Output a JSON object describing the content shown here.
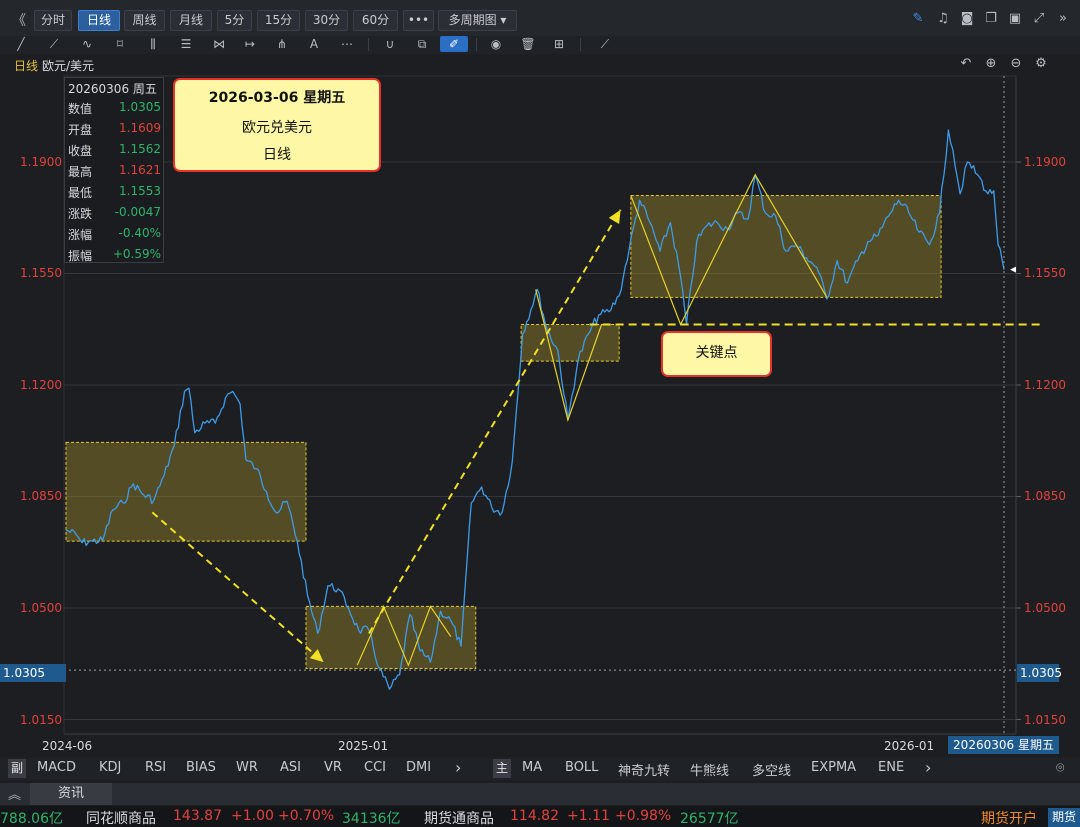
{
  "toolbar": {
    "collapse_glyph": "《",
    "periods": [
      "分时",
      "日线",
      "周线",
      "月线",
      "5分",
      "15分",
      "30分",
      "60分",
      "•••"
    ],
    "active_period": "日线",
    "multi_period": "多周期图 ▾",
    "right_icons": [
      "pencil-icon",
      "bell-icon",
      "camera-icon",
      "copy-icon",
      "monitor-icon",
      "fullscreen-icon",
      "expand-right-icon"
    ]
  },
  "drawing_tools": [
    "line-tool-icon",
    "ray-tool-icon",
    "polyline-tool-icon",
    "rect-tool-icon",
    "fib-tool-icon",
    "channel-tool-icon",
    "gann-tool-icon",
    "measure-tool-icon",
    "pitchfork-tool-icon",
    "text-tool-icon",
    "more-tools-icon",
    "magnet-icon",
    "layer-icon",
    "highlight-pen-icon",
    "eye-icon",
    "trash-icon",
    "grid-icon",
    "ruler-icon"
  ],
  "chart": {
    "period_label": "日线",
    "symbol_label": "欧元/美元",
    "controls": [
      "undo-icon",
      "zoom-in-icon",
      "zoom-out-icon",
      "settings-icon"
    ],
    "info": {
      "header": "20260306  周五",
      "rows": [
        {
          "k": "数值",
          "v": "1.0305",
          "c": "#2fb36a"
        },
        {
          "k": "开盘",
          "v": "1.1609",
          "c": "#e0433b"
        },
        {
          "k": "收盘",
          "v": "1.1562",
          "c": "#2fb36a"
        },
        {
          "k": "最高",
          "v": "1.1621",
          "c": "#e0433b"
        },
        {
          "k": "最低",
          "v": "1.1553",
          "c": "#2fb36a"
        },
        {
          "k": "涨跌",
          "v": "-0.0047",
          "c": "#2fb36a"
        },
        {
          "k": "涨幅",
          "v": "-0.40%",
          "c": "#2fb36a"
        },
        {
          "k": "振幅",
          "v": "+0.59%",
          "c": "#2fb36a"
        }
      ]
    },
    "callout_date": {
      "line1": "2026-03-06 星期五",
      "line2": "欧元兑美元",
      "line3": "日线"
    },
    "callout_key": "关键点",
    "y_ticks": [
      "1.1900",
      "1.1550",
      "1.1200",
      "1.0850",
      "1.0500",
      "1.0150"
    ],
    "x_ticks": [
      "2024-06",
      "2025-01",
      "2026-01"
    ],
    "cursor_value": "1.0305",
    "cursor_date": "20260306 星期五"
  },
  "chart_data": {
    "type": "line",
    "title": "欧元/美元 日线",
    "x_ticks": [
      "2024-06",
      "2025-01",
      "2026-01"
    ],
    "y_ticks": [
      1.19,
      1.155,
      1.12,
      1.085,
      1.05,
      1.015
    ],
    "ylim": [
      1.011,
      1.203
    ],
    "series": [
      {
        "name": "欧元/美元",
        "color": "#3d9be9",
        "points": [
          [
            "2024-06-03",
            1.0745
          ],
          [
            "2024-06-10",
            1.073
          ],
          [
            "2024-06-14",
            1.0705
          ],
          [
            "2024-06-21",
            1.071
          ],
          [
            "2024-06-28",
            1.0712
          ],
          [
            "2024-07-05",
            1.0808
          ],
          [
            "2024-07-12",
            1.083
          ],
          [
            "2024-07-19",
            1.089
          ],
          [
            "2024-07-26",
            1.0855
          ],
          [
            "2024-08-02",
            1.0838
          ],
          [
            "2024-08-09",
            1.0915
          ],
          [
            "2024-08-16",
            1.101
          ],
          [
            "2024-08-23",
            1.118
          ],
          [
            "2024-08-26",
            1.119
          ],
          [
            "2024-08-30",
            1.105
          ],
          [
            "2024-09-06",
            1.108
          ],
          [
            "2024-09-13",
            1.108
          ],
          [
            "2024-09-20",
            1.116
          ],
          [
            "2024-09-25",
            1.118
          ],
          [
            "2024-09-30",
            1.114
          ],
          [
            "2024-10-04",
            1.0965
          ],
          [
            "2024-10-11",
            1.0938
          ],
          [
            "2024-10-18",
            1.0866
          ],
          [
            "2024-10-25",
            1.0798
          ],
          [
            "2024-11-01",
            1.0835
          ],
          [
            "2024-11-08",
            1.071
          ],
          [
            "2024-11-15",
            1.054
          ],
          [
            "2024-11-22",
            1.042
          ],
          [
            "2024-11-29",
            1.057
          ],
          [
            "2024-12-06",
            1.056
          ],
          [
            "2024-12-13",
            1.05
          ],
          [
            "2024-12-20",
            1.043
          ],
          [
            "2024-12-27",
            1.043
          ],
          [
            "2025-01-03",
            1.031
          ],
          [
            "2025-01-10",
            1.0245
          ],
          [
            "2025-01-17",
            1.029
          ],
          [
            "2025-01-24",
            1.048
          ],
          [
            "2025-01-31",
            1.0365
          ],
          [
            "2025-02-07",
            1.033
          ],
          [
            "2025-02-14",
            1.049
          ],
          [
            "2025-02-21",
            1.046
          ],
          [
            "2025-02-28",
            1.038
          ],
          [
            "2025-03-07",
            1.083
          ],
          [
            "2025-03-14",
            1.088
          ],
          [
            "2025-03-21",
            1.0815
          ],
          [
            "2025-03-28",
            1.08
          ],
          [
            "2025-04-04",
            1.096
          ],
          [
            "2025-04-11",
            1.136
          ],
          [
            "2025-04-21",
            1.15
          ],
          [
            "2025-04-28",
            1.137
          ],
          [
            "2025-05-05",
            1.131
          ],
          [
            "2025-05-12",
            1.109
          ],
          [
            "2025-05-19",
            1.128
          ],
          [
            "2025-05-26",
            1.136
          ],
          [
            "2025-06-02",
            1.142
          ],
          [
            "2025-06-09",
            1.143
          ],
          [
            "2025-06-16",
            1.148
          ],
          [
            "2025-06-23",
            1.163
          ],
          [
            "2025-06-30",
            1.178
          ],
          [
            "2025-07-07",
            1.171
          ],
          [
            "2025-07-14",
            1.162
          ],
          [
            "2025-07-21",
            1.171
          ],
          [
            "2025-07-28",
            1.154
          ],
          [
            "2025-08-01",
            1.139
          ],
          [
            "2025-08-08",
            1.165
          ],
          [
            "2025-08-15",
            1.17
          ],
          [
            "2025-08-22",
            1.171
          ],
          [
            "2025-08-29",
            1.169
          ],
          [
            "2025-09-05",
            1.174
          ],
          [
            "2025-09-12",
            1.172
          ],
          [
            "2025-09-17",
            1.186
          ],
          [
            "2025-09-24",
            1.174
          ],
          [
            "2025-10-01",
            1.173
          ],
          [
            "2025-10-08",
            1.162
          ],
          [
            "2025-10-15",
            1.164
          ],
          [
            "2025-10-22",
            1.16
          ],
          [
            "2025-10-29",
            1.157
          ],
          [
            "2025-11-05",
            1.147
          ],
          [
            "2025-11-12",
            1.159
          ],
          [
            "2025-11-19",
            1.152
          ],
          [
            "2025-11-26",
            1.159
          ],
          [
            "2025-12-03",
            1.165
          ],
          [
            "2025-12-10",
            1.167
          ],
          [
            "2025-12-17",
            1.173
          ],
          [
            "2025-12-24",
            1.178
          ],
          [
            "2025-12-31",
            1.174
          ],
          [
            "2026-01-07",
            1.168
          ],
          [
            "2026-01-14",
            1.164
          ],
          [
            "2026-01-21",
            1.174
          ],
          [
            "2026-01-27",
            1.2
          ],
          [
            "2026-01-30",
            1.194
          ],
          [
            "2026-02-04",
            1.18
          ],
          [
            "2026-02-09",
            1.19
          ],
          [
            "2026-02-16",
            1.186
          ],
          [
            "2026-02-23",
            1.18
          ],
          [
            "2026-02-27",
            1.181
          ],
          [
            "2026-03-02",
            1.164
          ],
          [
            "2026-03-06",
            1.1562
          ]
        ]
      }
    ],
    "annotations": {
      "boxes": [
        {
          "from": "2024-06-03",
          "to": "2024-11-14",
          "low": 1.071,
          "high": 1.102
        },
        {
          "from": "2024-11-14",
          "to": "2025-03-10",
          "low": 1.031,
          "high": 1.0505
        },
        {
          "from": "2025-04-10",
          "to": "2025-06-16",
          "low": 1.1275,
          "high": 1.139
        },
        {
          "from": "2025-06-24",
          "to": "2026-01-22",
          "low": 1.1475,
          "high": 1.1795
        }
      ],
      "trend_arrows": [
        {
          "from": [
            "2024-08-01",
            1.08
          ],
          "to": [
            "2024-11-26",
            1.033
          ]
        },
        {
          "from": [
            "2024-12-27",
            1.042
          ],
          "to": [
            "2025-06-17",
            1.175
          ]
        }
      ],
      "zigzags": [
        [
          [
            "2024-12-19",
            1.032
          ],
          [
            "2025-01-06",
            1.0505
          ],
          [
            "2025-01-23",
            1.032
          ],
          [
            "2025-02-07",
            1.0505
          ],
          [
            "2025-02-21",
            1.041
          ]
        ],
        [
          [
            "2025-04-20",
            1.15
          ],
          [
            "2025-05-12",
            1.109
          ],
          [
            "2025-06-04",
            1.139
          ]
        ],
        [
          [
            "2025-06-24",
            1.1795
          ],
          [
            "2025-07-28",
            1.139
          ],
          [
            "2025-09-17",
            1.186
          ],
          [
            "2025-11-05",
            1.1475
          ]
        ]
      ],
      "key_level": {
        "value": 1.139,
        "from": "2025-06-30",
        "to": "2026-03-06"
      },
      "cursor": {
        "date": "2026-03-06",
        "value": 1.0305
      }
    }
  },
  "indicators": {
    "head1": "副",
    "list1": [
      "MACD",
      "KDJ",
      "RSI",
      "BIAS",
      "WR",
      "ASI",
      "VR",
      "CCI",
      "DMI"
    ],
    "head2": "主",
    "list2": [
      "MA",
      "BOLL",
      "神奇九转",
      "牛熊线",
      "多空线",
      "EXPMA",
      "ENE"
    ],
    "more": "›"
  },
  "news": {
    "tab": "资讯",
    "arrow": "︽"
  },
  "ticker": {
    "t0": "788.06亿",
    "name1": "同花顺商品",
    "p1": "143.87",
    "c1": "+1.00",
    "pc1": "+0.70%",
    "v1": "34136亿",
    "name2": "期货通商品",
    "p2": "114.82",
    "c2": "+1.11",
    "pc2": "+0.98%",
    "v2": "26577亿",
    "open_account": "期货开户",
    "futures_btn": "期货"
  }
}
